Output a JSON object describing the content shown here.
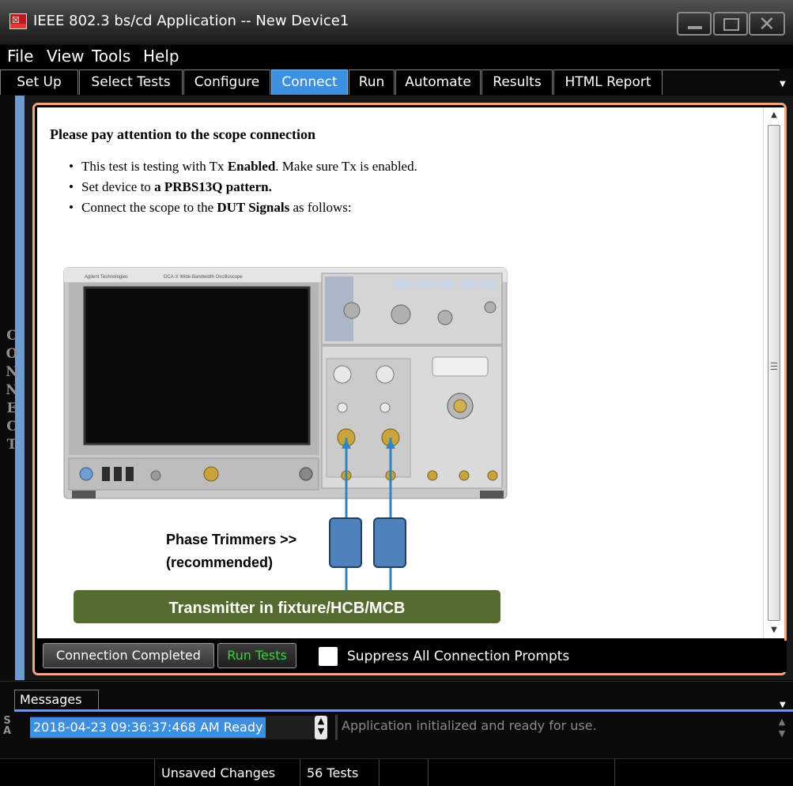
{
  "window": {
    "title": "IEEE 802.3 bs/cd Application -- New Device1"
  },
  "menu": [
    "File",
    "View",
    "Tools",
    "Help"
  ],
  "tabs": [
    "Set Up",
    "Select Tests",
    "Configure",
    "Connect",
    "Run",
    "Automate",
    "Results",
    "HTML Report"
  ],
  "active_tab": "Connect",
  "side_label": [
    "C",
    "O",
    "N",
    "N",
    "E",
    "C",
    "T"
  ],
  "content": {
    "heading": "Please pay attention to the scope connection",
    "bullet1": {
      "a": "This test is testing with Tx ",
      "b": "Enabled",
      "c": ". Make sure Tx is enabled."
    },
    "bullet2": {
      "a": "Set device to ",
      "b": "a PRBS13Q pattern."
    },
    "bullet3": {
      "a": "Connect the scope to the ",
      "b": "DUT Signals",
      "c": " as follows:"
    },
    "diagram": {
      "trimmer_label_line1": "Phase Trimmers >>",
      "trimmer_label_line2": "(recommended)",
      "fixture_label": "Transmitter in fixture/HCB/MCB",
      "scope_brand": "Agilent Technologies",
      "scope_model": "DCA-X Wide-Bandwidth Oscilloscope"
    }
  },
  "buttons": {
    "connection_completed": "Connection Completed",
    "run_tests": "Run Tests",
    "suppress_label": "Suppress All Connection Prompts"
  },
  "messages": {
    "tab_label": "Messages",
    "side_label": [
      "S",
      "A"
    ],
    "entry": "2018-04-23 09:36:37:468 AM Ready",
    "detail": "Application initialized and ready for use."
  },
  "status": {
    "unsaved": "Unsaved Changes",
    "tests": "56 Tests"
  },
  "colors": {
    "active_tab": "#3d8fe0",
    "panel_border": "#f4a582",
    "run_tests_text": "#3ed03e",
    "fixture_fill": "#556b2f",
    "trimmer_fill": "#4f81bd",
    "cable": "#2e86c1"
  }
}
